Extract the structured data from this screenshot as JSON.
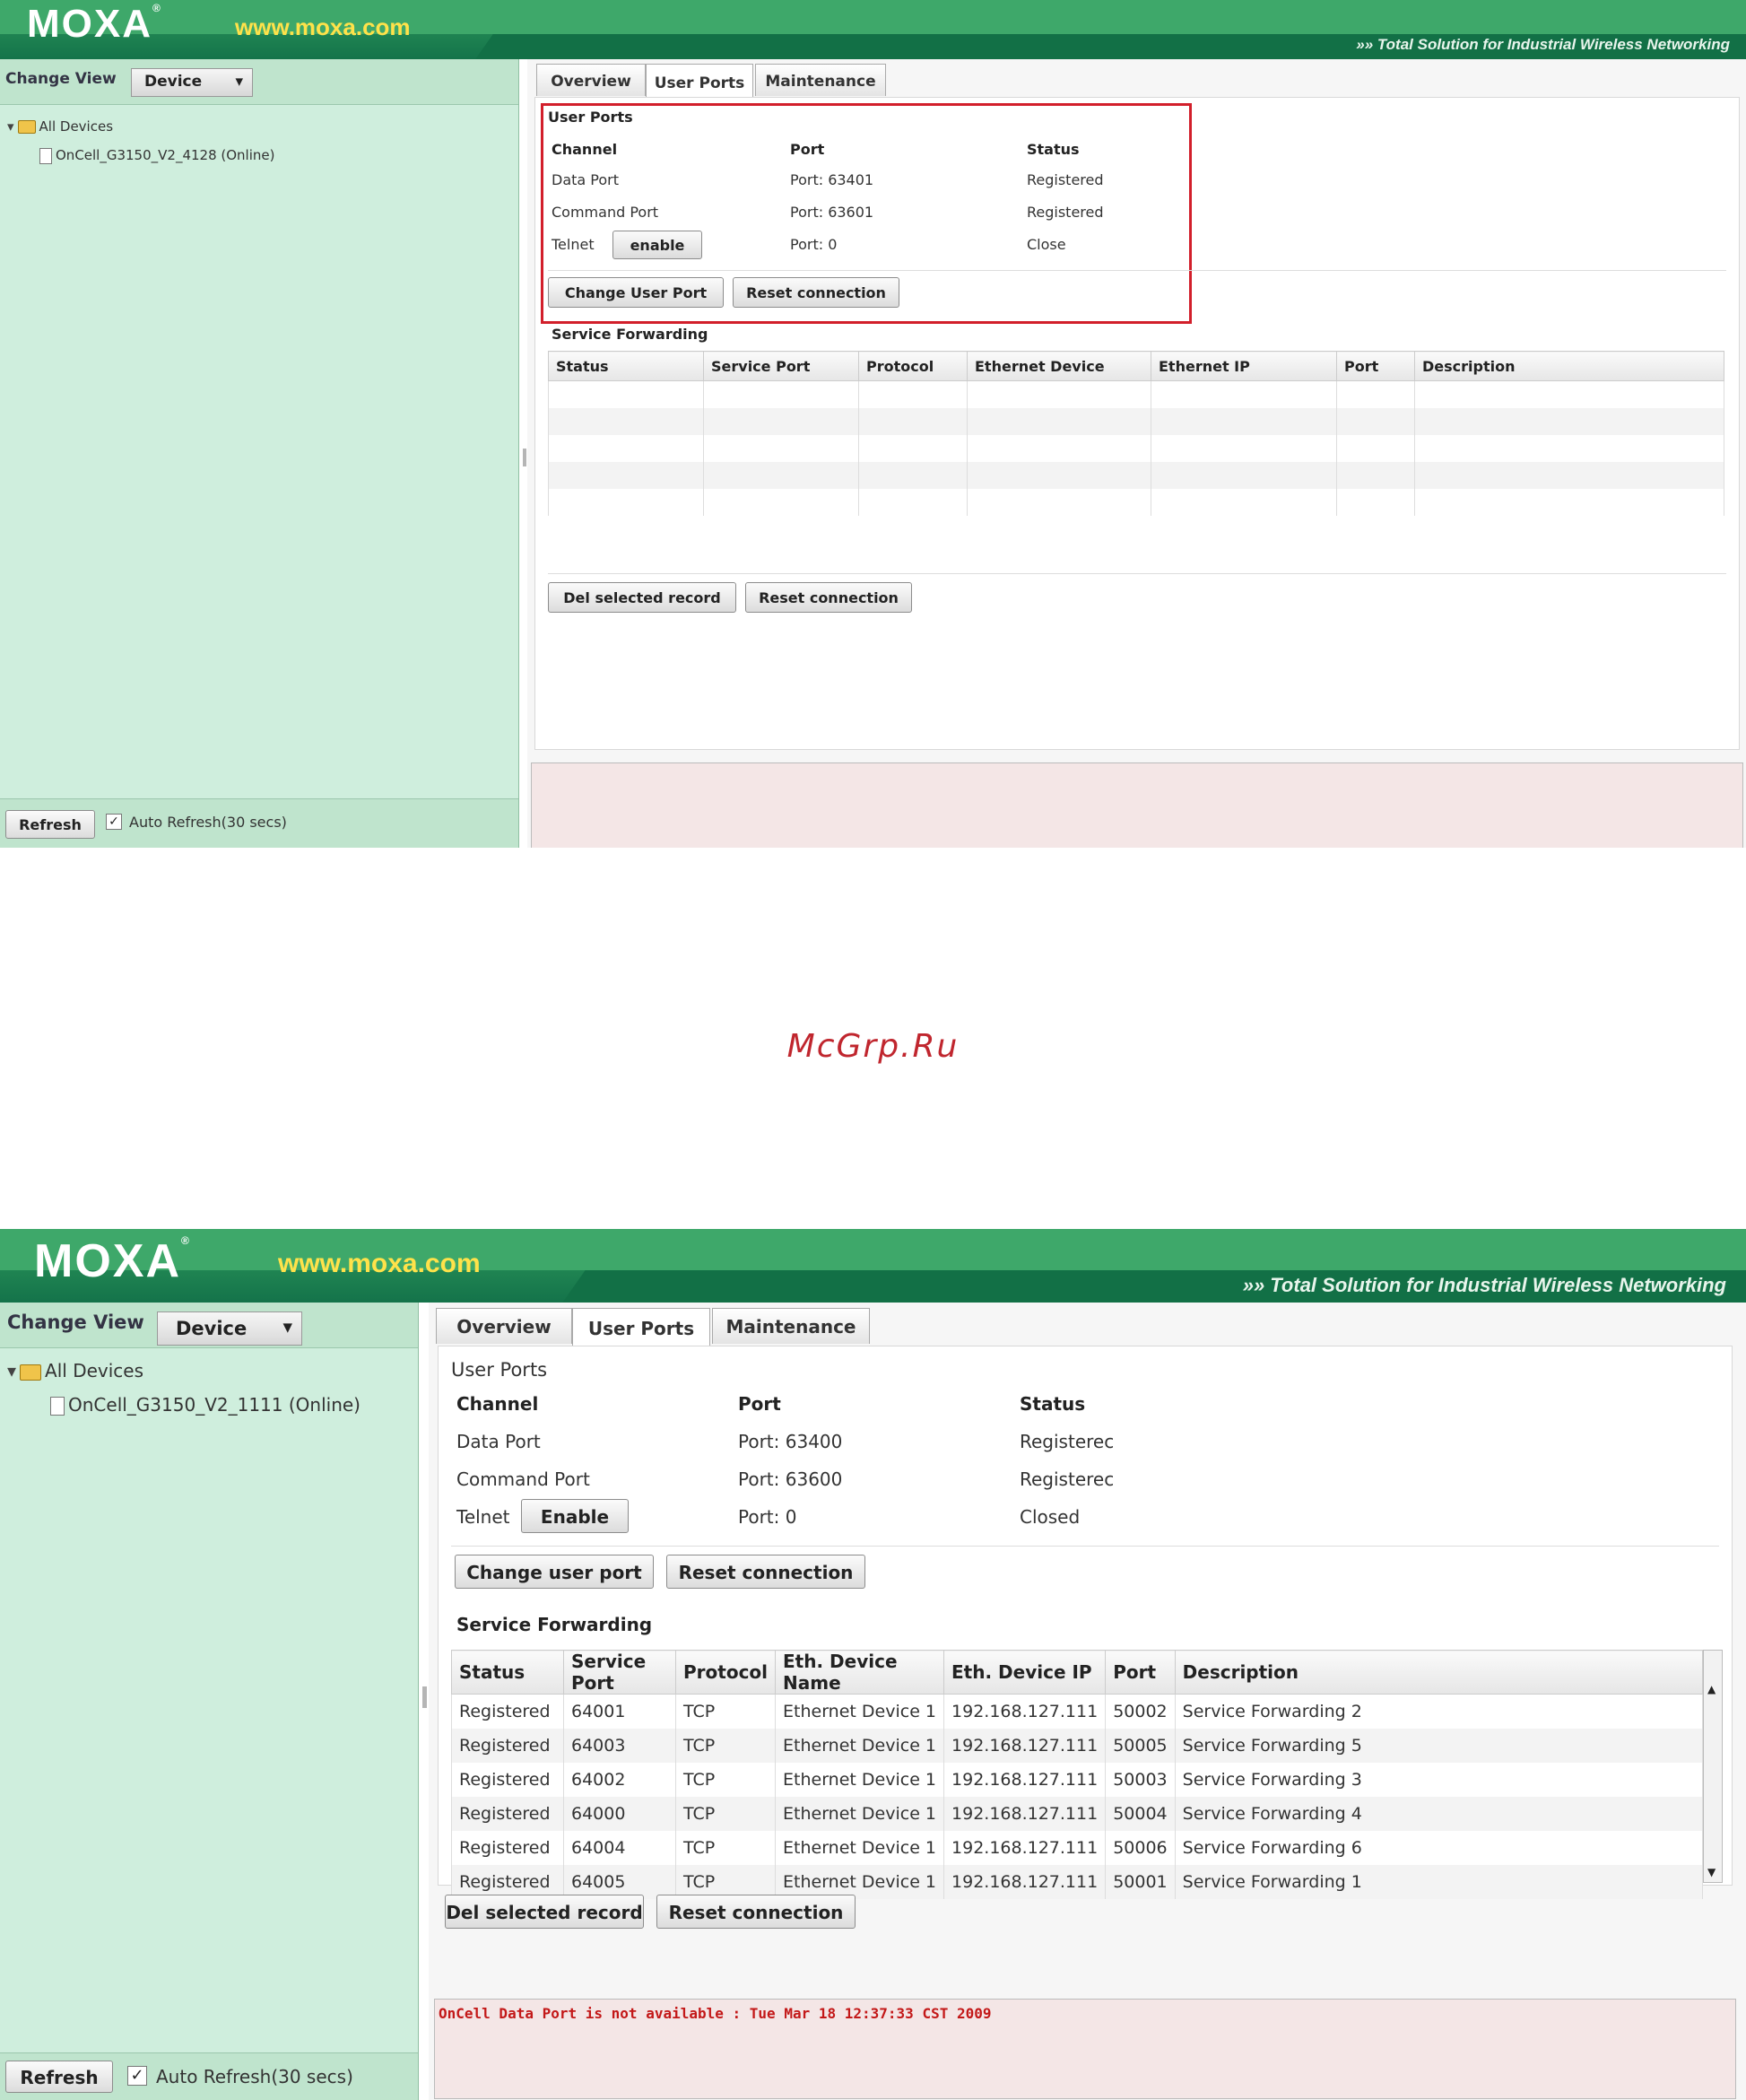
{
  "brand": {
    "logo": "MOXA",
    "url": "www.moxa.com",
    "tagline": "»» Total Solution for Industrial Wireless Networking"
  },
  "watermark": "McGrp.Ru",
  "screen1": {
    "change_view_label": "Change View",
    "view_select": "Device",
    "tree": {
      "root": "All Devices",
      "device": "OnCell_G3150_V2_4128 (Online)"
    },
    "refresh_button": "Refresh",
    "auto_refresh": "Auto Refresh(30 secs)",
    "tabs": [
      "Overview",
      "User Ports",
      "Maintenance"
    ],
    "user_ports": {
      "title": "User Ports",
      "headers": {
        "channel": "Channel",
        "port": "Port",
        "status": "Status"
      },
      "rows": [
        {
          "channel": "Data Port",
          "port": "Port: 63401",
          "status": "Registered"
        },
        {
          "channel": "Command Port",
          "port": "Port: 63601",
          "status": "Registered"
        },
        {
          "channel": "Telnet",
          "port": "Port: 0",
          "status": "Close"
        }
      ],
      "telnet_button": "enable",
      "change_button": "Change User Port",
      "reset_button": "Reset connection"
    },
    "service_forwarding": {
      "title": "Service Forwarding",
      "columns": [
        "Status",
        "Service Port",
        "Protocol",
        "Ethernet Device",
        "Ethernet IP",
        "Port",
        "Description"
      ],
      "del_button": "Del selected record",
      "reset_button": "Reset connection"
    }
  },
  "screen2": {
    "change_view_label": "Change View",
    "view_select": "Device",
    "tree": {
      "root": "All Devices",
      "device": "OnCell_G3150_V2_1111 (Online)"
    },
    "refresh_button": "Refresh",
    "auto_refresh": "Auto Refresh(30 secs)",
    "tabs": [
      "Overview",
      "User Ports",
      "Maintenance"
    ],
    "user_ports": {
      "title": "User Ports",
      "headers": {
        "channel": "Channel",
        "port": "Port",
        "status": "Status"
      },
      "rows": [
        {
          "channel": "Data Port",
          "port": "Port: 63400",
          "status": "Registerec"
        },
        {
          "channel": "Command Port",
          "port": "Port: 63600",
          "status": "Registerec"
        },
        {
          "channel": "Telnet",
          "port": "Port: 0",
          "status": "Closed"
        }
      ],
      "telnet_button": "Enable",
      "change_button": "Change user port",
      "reset_button": "Reset connection"
    },
    "service_forwarding": {
      "title": "Service Forwarding",
      "columns": [
        "Status",
        "Service Port",
        "Protocol",
        "Eth. Device Name",
        "Eth. Device IP",
        "Port",
        "Description"
      ],
      "rows": [
        [
          "Registered",
          "64001",
          "TCP",
          "Ethernet Device 1",
          "192.168.127.111",
          "50002",
          "Service Forwarding 2"
        ],
        [
          "Registered",
          "64003",
          "TCP",
          "Ethernet Device 1",
          "192.168.127.111",
          "50005",
          "Service Forwarding 5"
        ],
        [
          "Registered",
          "64002",
          "TCP",
          "Ethernet Device 1",
          "192.168.127.111",
          "50003",
          "Service Forwarding 3"
        ],
        [
          "Registered",
          "64000",
          "TCP",
          "Ethernet Device 1",
          "192.168.127.111",
          "50004",
          "Service Forwarding 4"
        ],
        [
          "Registered",
          "64004",
          "TCP",
          "Ethernet Device 1",
          "192.168.127.111",
          "50006",
          "Service Forwarding 6"
        ],
        [
          "Registered",
          "64005",
          "TCP",
          "Ethernet Device 1",
          "192.168.127.111",
          "50001",
          "Service Forwarding 1"
        ]
      ],
      "del_button": "Del selected record",
      "reset_button": "Reset connection"
    },
    "status_message": "OnCell Data Port is not available : Tue Mar 18 12:37:33 CST 2009"
  },
  "colors": {
    "banner": "#1f8a55",
    "sidebar": "#cfeedd",
    "highlight": "#d21f2b",
    "error_text": "#c31818"
  },
  "icons": {
    "tree_toggle": "triangle-down-icon",
    "folder": "folder-icon",
    "device": "document-icon",
    "dropdown": "chevron-down-icon",
    "checkbox": "checkmark-icon"
  }
}
